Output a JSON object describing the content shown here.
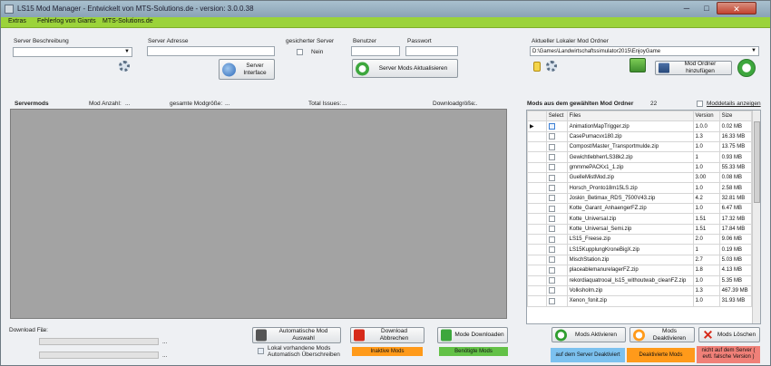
{
  "window": {
    "title": "LS15 Mod Manager - Entwickelt von MTS-Solutions.de - version: 3.0.0.38",
    "minimize": "─",
    "maximize": "□",
    "close": "✕"
  },
  "menu": [
    "Extras",
    "Fehlerlog von Giants",
    "MTS-Solutions.de"
  ],
  "server": {
    "beschreibung_label": "Server Beschreibung",
    "adresse_label": "Server Adresse",
    "gesichert_label": "gesicherter Server",
    "gesichert_value": "Nein",
    "benutzer_label": "Benutzer",
    "passwort_label": "Passwort",
    "interface_button": "Server Interface",
    "mods_update_button": "Server Mods Aktualisieren"
  },
  "local": {
    "folder_label": "Aktueller Lokaler Mod Ordner",
    "folder_value": "D:\\Games\\Landwirtschaftssimulator2015\\EnjoyGame",
    "add_folder_button": "Mod Ordner hinzufügen"
  },
  "servermods": {
    "title": "Servermods",
    "anzahl": "Mod Anzahl:",
    "anzahl_value": "...",
    "groesse": "gesamte Modgröße:",
    "groesse_value": "...",
    "issues": "Total Issues:",
    "issues_value": "...",
    "download_size": "Downloadgröße:",
    "download_size_value": "...",
    "download_file_label": "Download File:",
    "download_file_value": "...",
    "progress1": "...",
    "progress2": "..."
  },
  "actions": {
    "auto_button": "Automatische Mod Auswahl",
    "abort_button": "Download Abbrechen",
    "download_button": "Mode Downloaden",
    "overwrite_label": "Lokal vorhandene Mods Automatisch Überschreiben",
    "inactive_mods": "Inaktive Mods",
    "needed_mods": "Benötigte Mods"
  },
  "local_mods": {
    "title": "Mods aus dem gewählten Mod Ordner",
    "count": "22",
    "details_label": "Moddetails anzeigen",
    "columns": [
      "",
      "Select",
      "Files",
      "Version",
      "Size"
    ],
    "rows": [
      {
        "file": "AnimationMapTrigger.zip",
        "version": "1.0.0",
        "size": "0.02 MB"
      },
      {
        "file": "CasePumacvx180.zip",
        "version": "1.3",
        "size": "16.33 MB"
      },
      {
        "file": "Compost/Master_Transportmulde.zip",
        "version": "1.0",
        "size": "13.75 MB"
      },
      {
        "file": "GewichtlebherrLS38k2.zip",
        "version": "1",
        "size": "0.93 MB"
      },
      {
        "file": "gmmmePACKx1_1.zip",
        "version": "1.0",
        "size": "55.33 MB"
      },
      {
        "file": "GuelleMistMod.zip",
        "version": "3.00",
        "size": "0.08 MB"
      },
      {
        "file": "Horsch_Pronto18m15LS.zip",
        "version": "1.0",
        "size": "2.58 MB"
      },
      {
        "file": "Joskin_Betimax_RDS_7500V43.zip",
        "version": "4.2",
        "size": "32.81 MB"
      },
      {
        "file": "Kotte_Garant_AnhaengerFZ.zip",
        "version": "1.0",
        "size": "6.47 MB"
      },
      {
        "file": "Kotte_Universal.zip",
        "version": "1.51",
        "size": "17.32 MB"
      },
      {
        "file": "Kotte_Universal_Semi.zip",
        "version": "1.51",
        "size": "17.84 MB"
      },
      {
        "file": "LS15_Freese.zip",
        "version": "2.0",
        "size": "9.06 MB"
      },
      {
        "file": "LS15KupplungKroneBigX.zip",
        "version": "1",
        "size": "0.19 MB"
      },
      {
        "file": "MischStation.zip",
        "version": "2.7",
        "size": "5.03 MB"
      },
      {
        "file": "placeablemanurelagerFZ.zip",
        "version": "1.8",
        "size": "4.13 MB"
      },
      {
        "file": "rekordiaquatrooal_ls15_withoutwab_cleanFZ.zip",
        "version": "1.0",
        "size": "5.35 MB"
      },
      {
        "file": "Volksholm.zip",
        "version": "1.3",
        "size": "467.39 MB"
      },
      {
        "file": "Xenon_fonit.zip",
        "version": "1.0",
        "size": "31.93 MB"
      }
    ]
  },
  "bottom_right": {
    "activate": "Mods Aktivieren",
    "deactivate": "Mods Deaktivieren",
    "delete": "Mods Löschen",
    "server_deactivated": "auf dem Server Deaktiviert",
    "deactivated_mods": "Deaktivierte Mods",
    "not_on_server": "nicht auf dem Server ( evtl. falsche Version )"
  },
  "colors": {
    "menubar": "#9bd33a",
    "green": "#2f9e2f",
    "orange": "#ff9a1a",
    "blue": "#7cc1ef",
    "red": "#d62a1a"
  }
}
